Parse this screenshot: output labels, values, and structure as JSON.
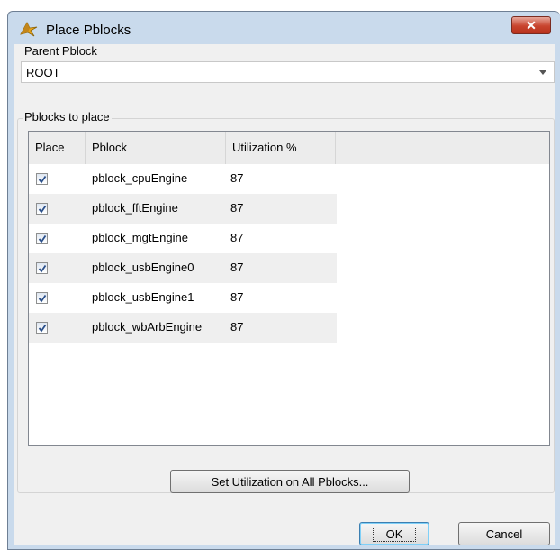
{
  "window": {
    "title": "Place Pblocks",
    "close_label": "✕"
  },
  "parent": {
    "label": "Parent Pblock",
    "value": "ROOT"
  },
  "pblocks_group": {
    "label": "Pblocks to place"
  },
  "table": {
    "headers": [
      "Place",
      "Pblock",
      "Utilization %"
    ],
    "rows": [
      {
        "checked": true,
        "name": "pblock_cpuEngine",
        "util": "87"
      },
      {
        "checked": true,
        "name": "pblock_fftEngine",
        "util": "87"
      },
      {
        "checked": true,
        "name": "pblock_mgtEngine",
        "util": "87"
      },
      {
        "checked": true,
        "name": "pblock_usbEngine0",
        "util": "87"
      },
      {
        "checked": true,
        "name": "pblock_usbEngine1",
        "util": "87"
      },
      {
        "checked": true,
        "name": "pblock_wbArbEngine",
        "util": "87"
      }
    ]
  },
  "buttons": {
    "set_util": "Set Utilization on All Pblocks...",
    "ok": "OK",
    "cancel": "Cancel"
  },
  "icons": {
    "app": "vivado-logo-icon",
    "close": "close-icon",
    "dropdown": "chevron-down-icon",
    "check": "checkbox-checked-icon"
  }
}
